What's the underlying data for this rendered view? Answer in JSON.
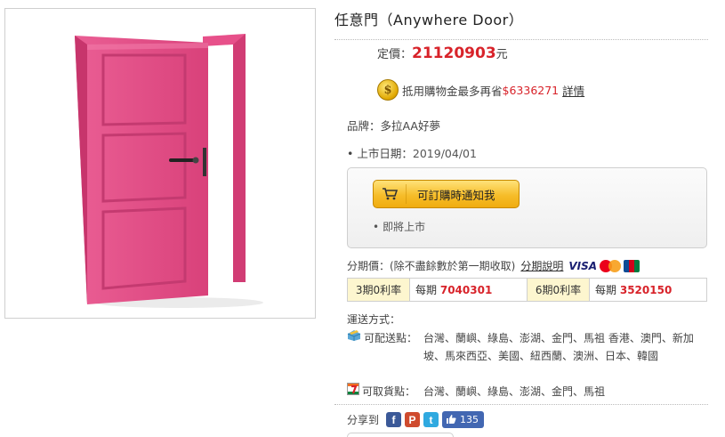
{
  "product": {
    "title": "任意門（Anywhere Door）",
    "image_alt": "pink open door"
  },
  "price": {
    "label": "定價：",
    "value": "21120903",
    "currency": "元"
  },
  "coupon": {
    "icon": "dollar-coin-icon",
    "text": "抵用購物金最多再省",
    "amount": "$6336271",
    "link": "詳情"
  },
  "brand": {
    "text": "品牌：多拉AA好夢"
  },
  "release": {
    "bullet": "•",
    "label": "上市日期：",
    "value": "2019/04/01"
  },
  "notify": {
    "button_label": "可訂購時通知我",
    "bullet": "•",
    "status": "即將上市"
  },
  "installment": {
    "label": "分期價：(除不盡餘數於第一期收取)",
    "link": "分期說明",
    "visa": "VISA",
    "rows": [
      {
        "term": "3期0利率",
        "per_label": "每期",
        "per_value": "7040301"
      },
      {
        "term": "6期0利率",
        "per_label": "每期",
        "per_value": "3520150"
      }
    ]
  },
  "shipping": {
    "header": "運送方式：",
    "deliver_label": "可配送點：",
    "deliver_areas": "台灣、蘭嶼、綠島、澎湖、金門、馬祖 香港、澳門、新加坡、馬來西亞、美國、紐西蘭、澳洲、日本、韓國",
    "pickup_label": "可取貨點：",
    "pickup_areas": "台灣、蘭嶼、綠島、澎湖、金門、馬祖"
  },
  "share": {
    "label": "分享到",
    "fb": "f",
    "plurk": "P",
    "twitter": "t",
    "like_count": "135"
  },
  "colors": {
    "price_red": "#d8232a",
    "door_pink": "#e8558c",
    "button_gold": "#f6bd2a"
  }
}
